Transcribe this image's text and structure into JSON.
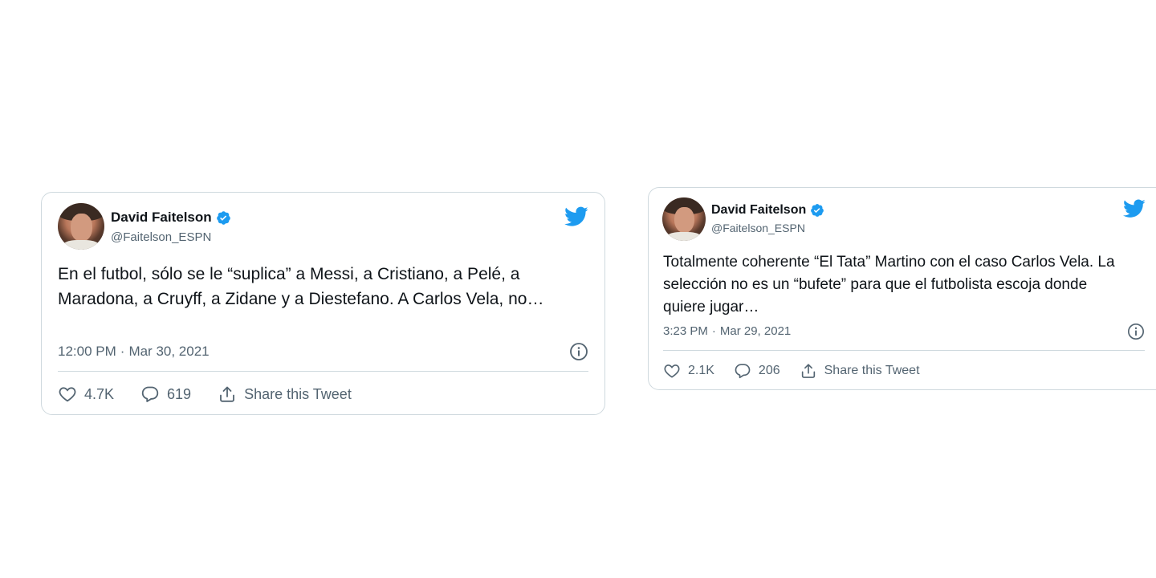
{
  "tweets": [
    {
      "author": {
        "name": "David Faitelson",
        "handle": "@Faitelson_ESPN",
        "verified_icon": "verified-badge-icon",
        "avatar": "avatar-photo"
      },
      "text": "En el futbol, sólo se le “suplica” a Messi, a Cristiano, a Pelé, a Maradona, a Cruyff, a Zidane y a Diestefano. A Carlos Vela, no…",
      "time": "12:00 PM",
      "separator": "·",
      "date": "Mar 30, 2021",
      "likes": "4.7K",
      "replies": "619",
      "share_label": "Share this Tweet"
    },
    {
      "author": {
        "name": "David Faitelson",
        "handle": "@Faitelson_ESPN",
        "verified_icon": "verified-badge-icon",
        "avatar": "avatar-photo"
      },
      "text": "Totalmente coherente “El Tata” Martino con el caso Carlos Vela. La selección no es un “bufete” para que el futbolista escoja donde quiere jugar…",
      "time": "3:23 PM",
      "separator": "·",
      "date": "Mar 29, 2021",
      "likes": "2.1K",
      "replies": "206",
      "share_label": "Share this Tweet"
    }
  ],
  "colors": {
    "brand_blue": "#1d9bf0",
    "text_primary": "#0f1419",
    "text_secondary": "#536471",
    "border": "#cfd9de"
  }
}
